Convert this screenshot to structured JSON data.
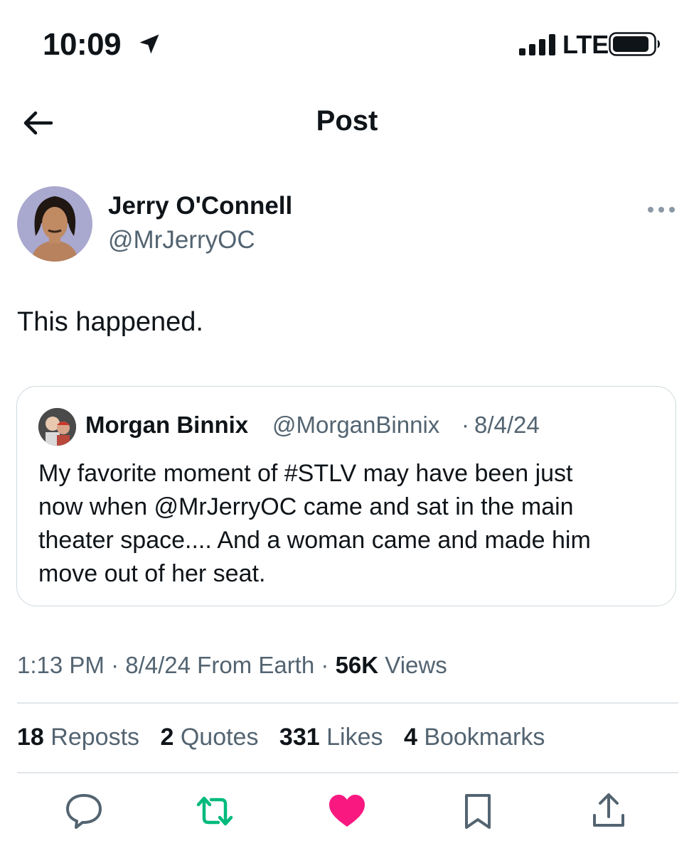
{
  "status_bar": {
    "time": "10:09",
    "network": "LTE",
    "location_icon": "location-arrow-icon",
    "signal_icon": "signal-bars-icon",
    "battery_icon": "battery-icon"
  },
  "header": {
    "title": "Post",
    "back_icon": "back-arrow-icon"
  },
  "post": {
    "author": {
      "name": "Jerry O'Connell",
      "handle": "@MrJerryOC"
    },
    "text": "This happened.",
    "quote": {
      "author_name": "Morgan Binnix",
      "author_handle": "@MorganBinnix",
      "separator": "·",
      "date": "8/4/24",
      "text_lines": [
        "My favorite moment of #STLV may have been just",
        "now when @MrJerryOC came and sat in the main",
        "theater space.... And a woman came and made him",
        "move out of her seat."
      ]
    },
    "meta": {
      "time": "1:13 PM",
      "separator": "·",
      "date": "8/4/24",
      "source": "From Earth",
      "views_count": "56K",
      "views_label": "Views"
    },
    "stats": {
      "reposts_count": "18",
      "reposts_label": "Reposts",
      "quotes_count": "2",
      "quotes_label": "Quotes",
      "likes_count": "331",
      "likes_label": "Likes",
      "bookmarks_count": "4",
      "bookmarks_label": "Bookmarks"
    }
  },
  "actions": {
    "reply_icon": "reply-icon",
    "repost_icon": "repost-icon",
    "like_icon": "heart-icon",
    "bookmark_icon": "bookmark-icon",
    "share_icon": "share-icon",
    "repost_color": "#00ba7c",
    "like_color": "#f91880",
    "icon_color": "#536471"
  }
}
